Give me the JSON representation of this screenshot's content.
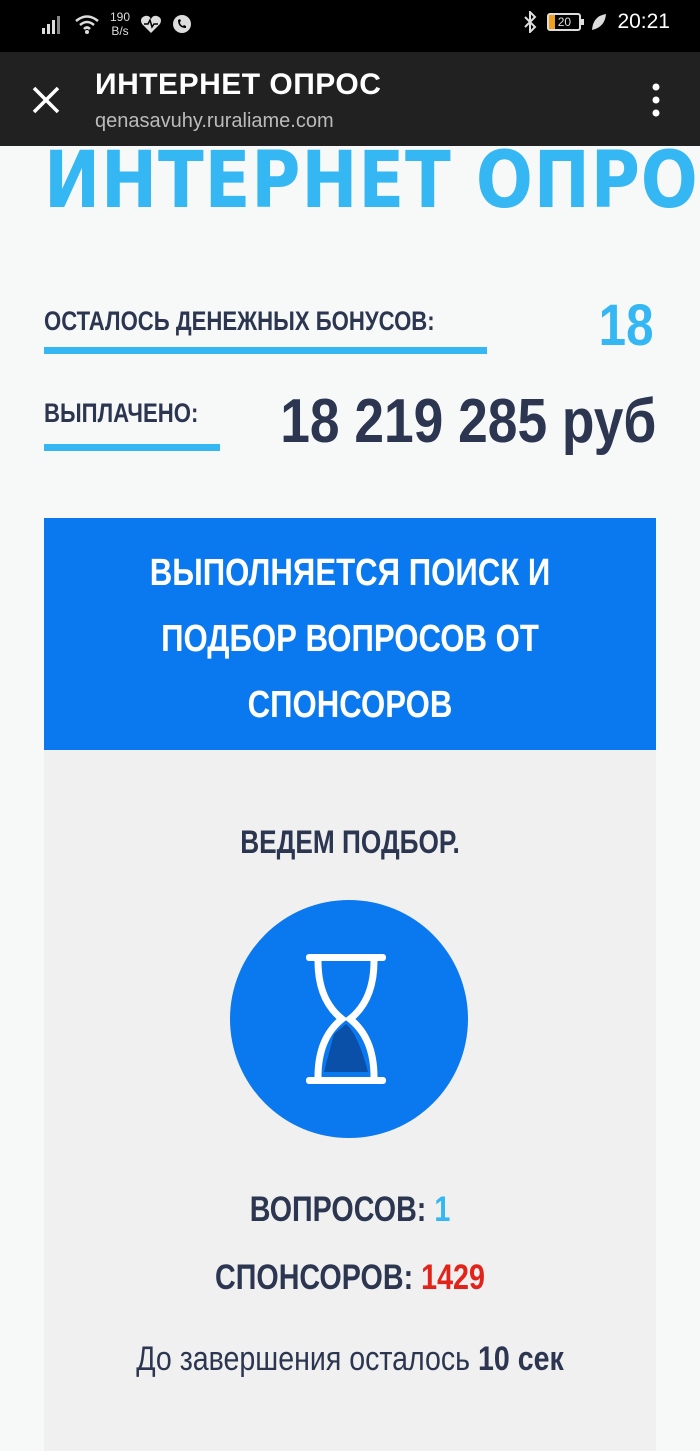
{
  "status_bar": {
    "net_speed_value": "190",
    "net_speed_unit": "B/s",
    "battery": "20",
    "time": "20:21"
  },
  "toolbar": {
    "title": "ИНТЕРНЕТ ОПРОС",
    "url": "qenasavuhy.ruraliame.com"
  },
  "page": {
    "big_title": "ИНТЕРНЕТ ОПРОС",
    "bonuses_label": "ОСТАЛОСЬ ДЕНЕЖНЫХ БОНУСОВ:",
    "bonuses_value": "18",
    "paid_label": "ВЫПЛАЧЕНО:",
    "paid_value": "18 219 285 руб"
  },
  "card": {
    "header_lines": [
      "ВЫПОЛНЯЕТСЯ ПОИСК И",
      "ПОДБОР ВОПРОСОВ ОТ",
      "СПОНСОРОВ"
    ],
    "selecting": "ВЕДЕМ ПОДБОР.",
    "questions_label": "ВОПРОСОВ:",
    "questions_value": "1",
    "sponsors_label": "СПОНСОРОВ:",
    "sponsors_value": "1429",
    "remaining_prefix": "До завершения осталось",
    "remaining_value": "10 сек"
  },
  "colors": {
    "accent_light_blue": "#35b7f3",
    "header_blue": "#0a79ef",
    "dark_text": "#2c3650",
    "red": "#e2231a"
  },
  "icons": [
    "signal-icon",
    "wifi-icon",
    "heart-icon",
    "phone-icon",
    "bluetooth-icon",
    "battery-icon",
    "leaf-icon",
    "close-icon",
    "more-vert-icon",
    "hourglass-icon"
  ]
}
